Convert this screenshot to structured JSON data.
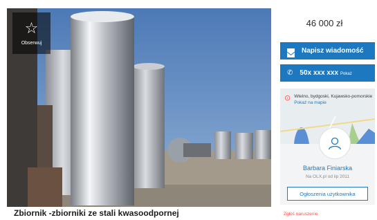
{
  "photo": {
    "favorite_icon": "star-outline-icon",
    "favorite_label": "Obserwuj"
  },
  "listing": {
    "title": "Zbiornik -zbiorniki ze stali kwasoodpornej"
  },
  "sidebar": {
    "price": "46 000 zł",
    "message_icon": "envelope-icon",
    "message_button": "Napisz wiadomość",
    "phone_icon": "phone-icon",
    "phone_number": "50x xxx xxx",
    "phone_show": "Pokaż",
    "location": "Wtelno, bydgoski, Kujawsko-pomorskie",
    "map_link": "Pokaż na mapie",
    "user_name": "Barbara Finiarska",
    "user_since": "Na OLX.pl od lip 2011",
    "user_ads_button": "Ogłoszenia użytkownika",
    "report_link": "Zgłoś naruszenie"
  },
  "colors": {
    "accent": "#1d78bf",
    "report": "#ff4c4c"
  }
}
